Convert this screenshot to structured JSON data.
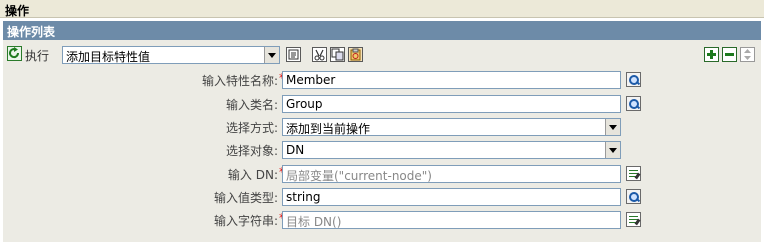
{
  "header": {
    "title": "操作"
  },
  "list": {
    "title": "操作列表"
  },
  "exec": {
    "label": "执行",
    "action_select": "添加目标特性值"
  },
  "fields": {
    "attr_name": {
      "label": "输入特性名称:",
      "required": "*",
      "value": "Member"
    },
    "class_name": {
      "label": "输入类名:",
      "value": "Group"
    },
    "mode": {
      "label": "选择方式:",
      "value": "添加到当前操作"
    },
    "target": {
      "label": "选择对象:",
      "value": "DN"
    },
    "dn": {
      "label": "输入 DN:",
      "required": "*",
      "value": "局部变量(\"current-node\")"
    },
    "value_type": {
      "label": "输入值类型:",
      "value": "string"
    },
    "string": {
      "label": "输入字符串:",
      "required": "*",
      "value": "目标 DN()"
    }
  },
  "icons": {
    "refresh": "refresh-icon",
    "help": "help-icon",
    "browse": "magnify-icon",
    "editor": "argument-builder-icon",
    "add": "plus-icon",
    "remove": "minus-icon",
    "move": "move-icon"
  },
  "colors": {
    "header_bar": "#6d8ba8",
    "panel": "#ecebe4",
    "required": "#dd0000"
  }
}
